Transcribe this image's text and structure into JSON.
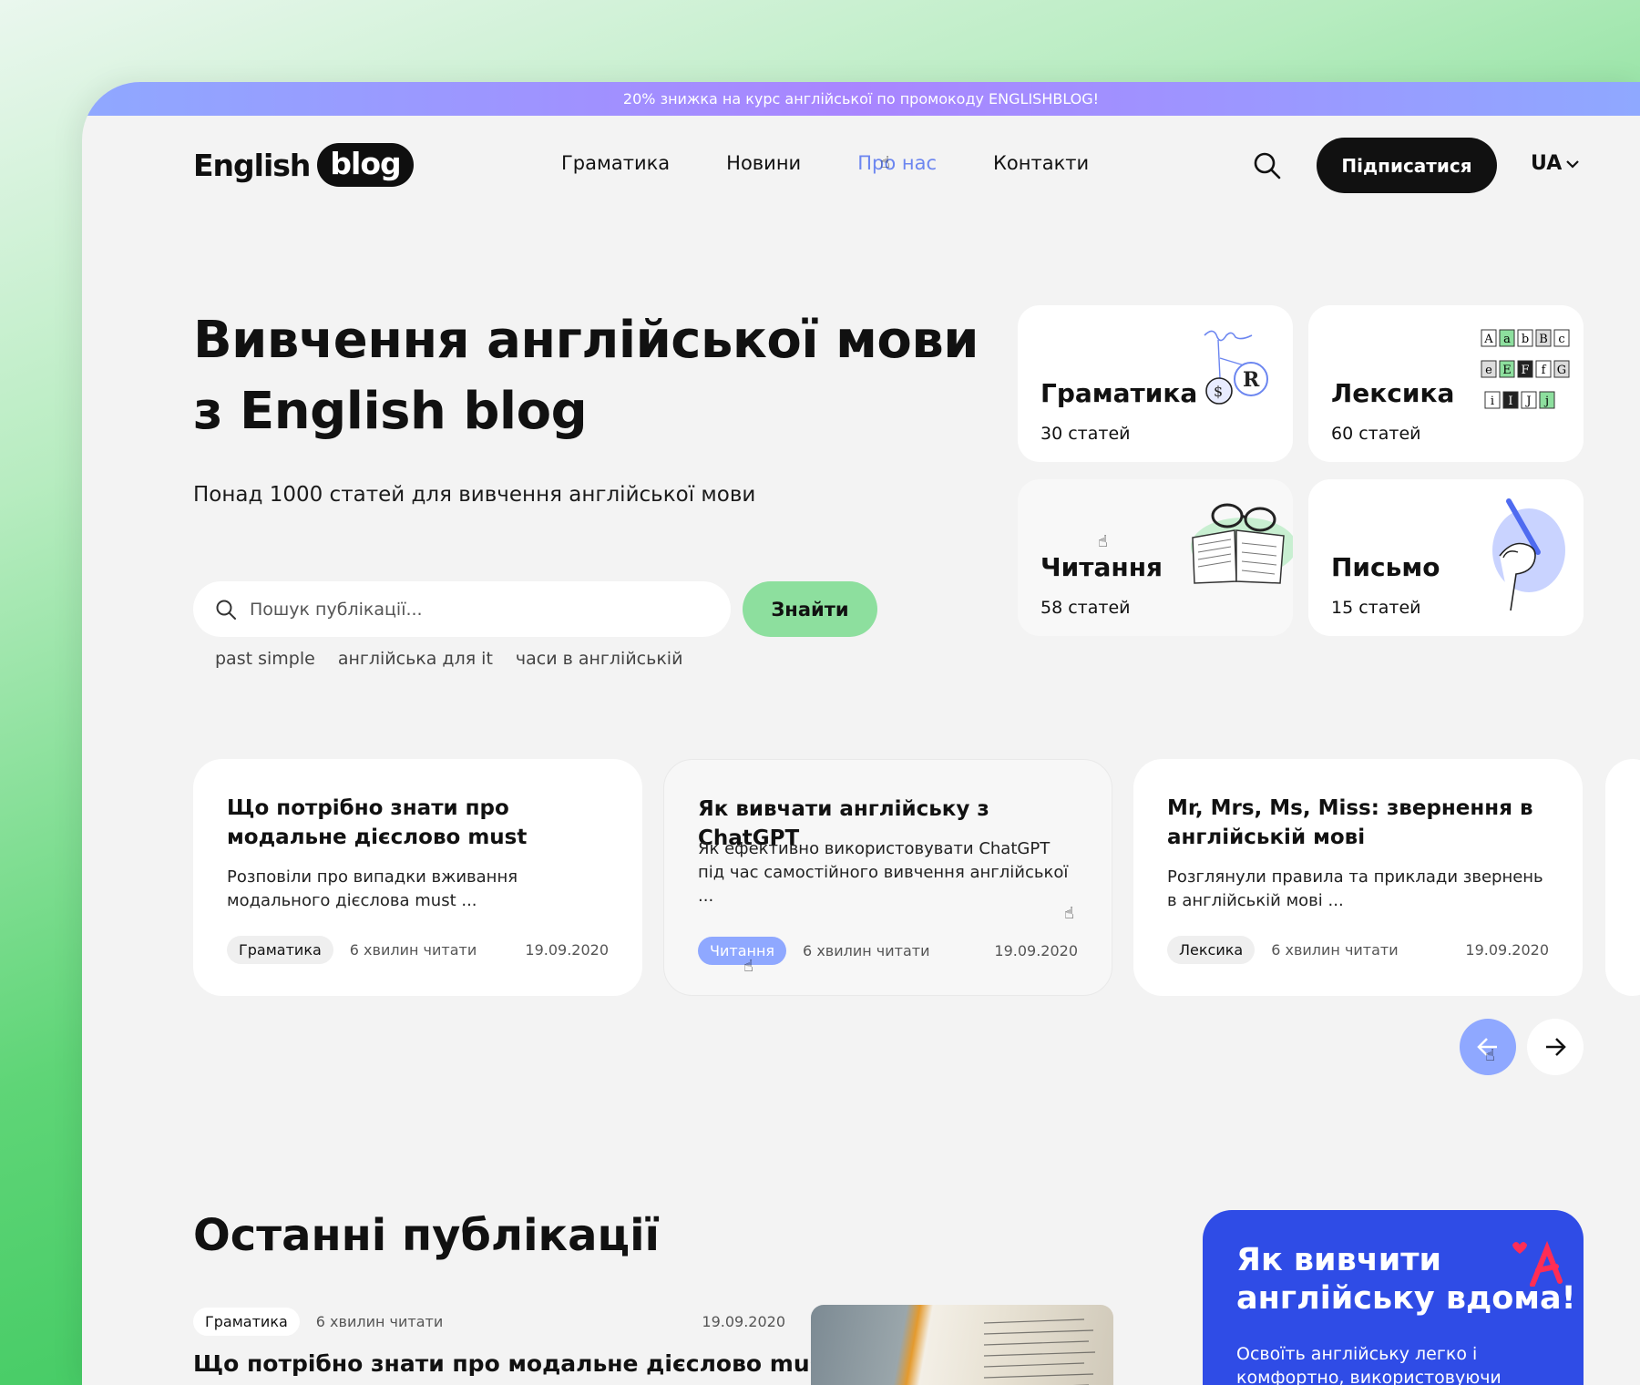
{
  "promo_banner": "20% знижка на курс англійської по промокоду ENGLISHBLOG!",
  "logo": {
    "word": "English",
    "pill": "blog"
  },
  "nav": [
    {
      "label": "Граматика"
    },
    {
      "label": "Новини"
    },
    {
      "label": "Про нас",
      "active": true
    },
    {
      "label": "Контакти"
    }
  ],
  "header": {
    "subscribe_label": "Підписатися",
    "language": "UA",
    "search_icon": "search-icon"
  },
  "hero": {
    "title_line1": "Вивчення англійської мови",
    "title_line2": "з English blog",
    "subtitle": "Понад 1000 статей для вивчення англійської мови",
    "search_placeholder": "Пошук публікації...",
    "find_label": "Знайти",
    "quick_tags": [
      "past simple",
      "англійська для it",
      "часи в англійській"
    ]
  },
  "categories": [
    {
      "name": "Граматика",
      "count": "30 статей"
    },
    {
      "name": "Лексика",
      "count": "60 статей"
    },
    {
      "name": "Читання",
      "count": "58 статей"
    },
    {
      "name": "Письмо",
      "count": "15 статей"
    }
  ],
  "articles": [
    {
      "title": "Що потрібно знати про модальне дієслово must",
      "desc": "Розповіли про випадки вживання модального дієслова must ...",
      "tag": "Граматика",
      "time": "6 хвилин читати",
      "date": "19.09.2020"
    },
    {
      "title": "Як вивчати англійську з ChatGPT",
      "desc": "Як ефективно використовувати ChatGPT під час самостійного вивчення англійської ...",
      "tag": "Читання",
      "time": "6 хвилин читати",
      "date": "19.09.2020"
    },
    {
      "title": "Mr, Mrs, Ms, Miss: звернення в англійській мові",
      "desc": "Розглянули правила та приклади звернень в англійській мові ...",
      "tag": "Лексика",
      "time": "6 хвилин читати",
      "date": "19.09.2020"
    }
  ],
  "latest": {
    "title": "Останні публікації",
    "tag": "Граматика",
    "time": "6 хвилин читати",
    "date": "19.09.2020",
    "headline": "Що потрібно знати про модальне дієслово must"
  },
  "promo_card": {
    "title_line1": "Як вивчити",
    "title_line2": "англійську вдома!",
    "text": "Освоїть англійську легко і комфортно, використовуючи"
  },
  "colors": {
    "accent": "#8fa8ff",
    "find_button": "#8ddf9e",
    "promo_card": "#2f4ce6",
    "dark": "#111111"
  }
}
